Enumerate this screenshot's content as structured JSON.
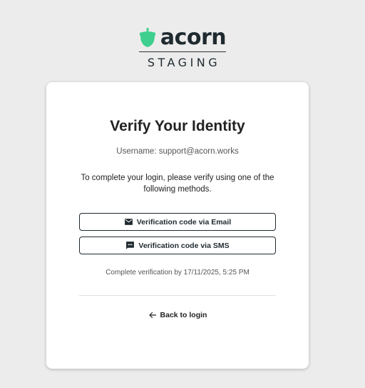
{
  "brand": {
    "wordmark": "acorn",
    "environment": "STAGING",
    "icon": "acorn-icon",
    "icon_color": "#3ecf8e"
  },
  "card": {
    "title": "Verify Your Identity",
    "username": "Username: support@acorn.works",
    "instruction": "To complete your login, please verify using one of the following methods.",
    "methods": [
      {
        "label": "Verification code via Email",
        "icon": "mail-icon"
      },
      {
        "label": "Verification code via SMS",
        "icon": "sms-icon"
      }
    ],
    "deadline": "Complete verification by 17/11/2025, 5:25 PM",
    "back_label": "Back to login",
    "back_icon": "arrow-left-icon"
  },
  "colors": {
    "background": "#ececec",
    "card": "#ffffff",
    "text_dark": "#1f2a30"
  }
}
